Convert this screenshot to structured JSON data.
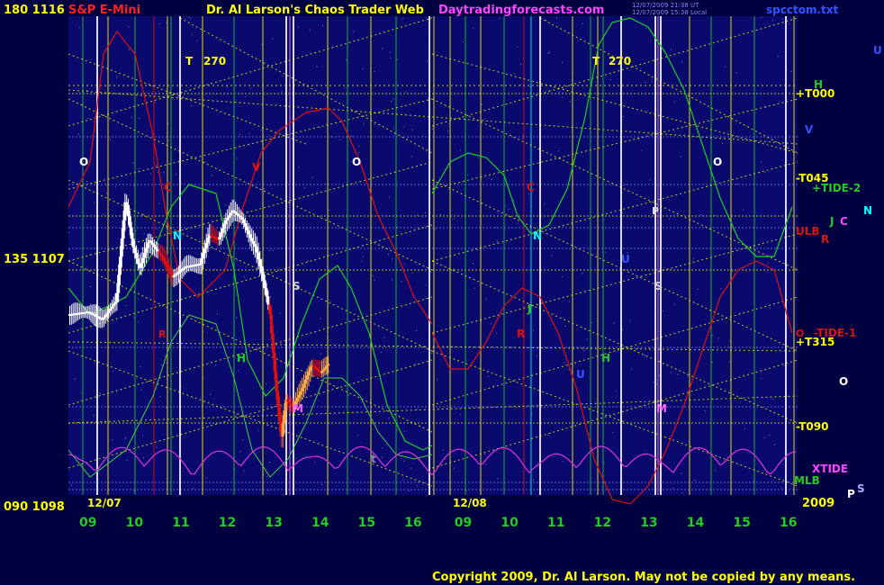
{
  "header": {
    "price_top": "180  1116",
    "symbol": "S&P E-Mini",
    "title": "Dr. Al Larson's Chaos Trader Web",
    "site": "Daytradingforecasts.com",
    "ts1": "12/07/2009 21:38 UT",
    "ts2": "12/07/2009 15:38 Local",
    "file": "spcctom.txt"
  },
  "footer": {
    "copyright": "Copyright 2009, Dr. Al Larson. May not be copied by any means."
  },
  "colors": {
    "background": "#000040",
    "plot_bg": "#0a0a6e",
    "yellow": "#ffff00",
    "green": "#22cc22",
    "red": "#dd1111",
    "magenta": "#dd33dd",
    "cyan": "#00ffff",
    "white": "#ffffff",
    "blue": "#3344ff"
  },
  "chart_data": {
    "type": "candlestick",
    "y_axis_labels": [
      {
        "text": "180  1116",
        "value": 1116
      },
      {
        "text": "135  1107",
        "value": 1107
      },
      {
        "text": "090  1098",
        "value": 1098
      }
    ],
    "ylim": [
      1098,
      1116
    ],
    "date_labels": [
      "12/07",
      "12/08",
      "2009"
    ],
    "x_ticks": [
      "09",
      "10",
      "11",
      "12",
      "13",
      "14",
      "15",
      "16",
      "09",
      "10",
      "11",
      "12",
      "13",
      "14",
      "15",
      "16"
    ],
    "price_path": [
      [
        0,
        1104.8
      ],
      [
        0.4,
        1104.9
      ],
      [
        0.7,
        1104.6
      ],
      [
        1.0,
        1105.3
      ],
      [
        1.2,
        1109.2
      ],
      [
        1.35,
        1107.4
      ],
      [
        1.5,
        1106.5
      ],
      [
        1.7,
        1107.6
      ],
      [
        2.0,
        1106.9
      ],
      [
        2.2,
        1106.2
      ],
      [
        2.5,
        1106.6
      ],
      [
        2.8,
        1106.7
      ],
      [
        3.0,
        1107.8
      ],
      [
        3.2,
        1107.6
      ],
      [
        3.35,
        1108.3
      ],
      [
        3.5,
        1108.7
      ],
      [
        3.7,
        1108.4
      ],
      [
        3.9,
        1107.6
      ],
      [
        4.0,
        1107.3
      ],
      [
        4.15,
        1106.2
      ],
      [
        4.3,
        1104.9
      ],
      [
        4.45,
        1101.8
      ],
      [
        4.55,
        1100.2
      ],
      [
        4.65,
        1101.6
      ],
      [
        4.8,
        1101.3
      ],
      [
        5.0,
        1102.0
      ],
      [
        5.2,
        1102.9
      ],
      [
        5.4,
        1102.6
      ],
      [
        5.6,
        1103.0
      ]
    ],
    "labels": [
      "T",
      "270",
      "T",
      "270",
      "O",
      "O",
      "O",
      "O",
      "C",
      "C",
      "N",
      "N",
      "S",
      "S",
      "H",
      "H",
      "H",
      "M",
      "M",
      "R",
      "R",
      "J",
      "J",
      "U",
      "U",
      "U",
      "V",
      "V",
      "P",
      "t",
      "l",
      "+T000",
      "-T045",
      "+TIDE-2",
      "ULB",
      "-TIDE-1",
      "+T315",
      "-T090",
      "XTIDE",
      "MLB",
      "C",
      "N",
      "P",
      "S",
      "O",
      "R"
    ]
  }
}
